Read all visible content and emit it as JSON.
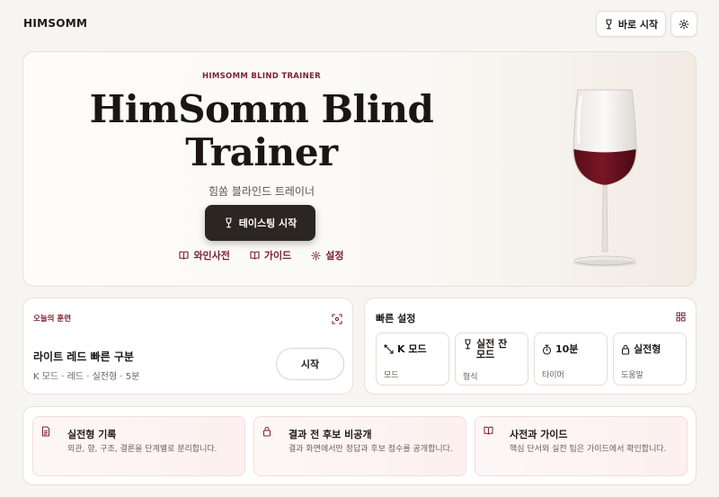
{
  "app": {
    "logo": "HIMSOMM"
  },
  "topbar": {
    "start_label": "바로 시작"
  },
  "hero": {
    "eyebrow": "HIMSOMM BLIND TRAINER",
    "title_line1": "HimSomm Blind",
    "title_line2": "Trainer",
    "subtitle": "힘쏨 블라인드 트레이너",
    "cta_label": "테이스팅 시작",
    "links": [
      {
        "label": "와인사전",
        "icon": "book-icon"
      },
      {
        "label": "가이드",
        "icon": "book-icon"
      },
      {
        "label": "설정",
        "icon": "gear-icon"
      }
    ]
  },
  "today": {
    "eyebrow": "오늘의 훈련",
    "title": "라이트 레드 빠른 구분",
    "meta": "K 모드 · 레드 · 실전형 · 5분",
    "start_label": "시작"
  },
  "quick": {
    "title": "빠른 설정",
    "options": [
      {
        "value": "K 모드",
        "label": "모드",
        "icon": "pen-icon"
      },
      {
        "value_line1": "실전 잔",
        "value_line2": "모드",
        "label": "형식",
        "icon": "wine-glass-icon"
      },
      {
        "value": "10분",
        "label": "타이머",
        "icon": "stopwatch-icon"
      },
      {
        "value": "실전형",
        "label": "도움말",
        "icon": "lock-icon"
      }
    ]
  },
  "features": [
    {
      "title": "실전형 기록",
      "desc": "외관, 향, 구조, 결론을 단계별로 분리합니다.",
      "icon": "document-icon"
    },
    {
      "title": "결과 전 후보 비공개",
      "desc": "결과 화면에서만 정답과 후보 점수를 공개합니다.",
      "icon": "lock-icon"
    },
    {
      "title": "사전과 가이드",
      "desc": "핵심 단서와 실전 팁은 가이드에서 확인합니다.",
      "icon": "book-icon"
    }
  ],
  "colors": {
    "accent": "#7a1f30",
    "dark_button": "#2c2622",
    "wine": "#6e1220"
  }
}
